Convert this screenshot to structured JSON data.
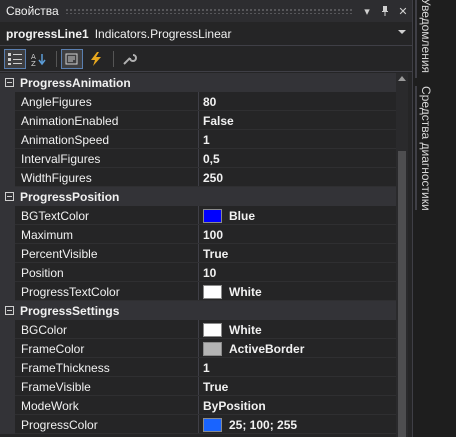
{
  "panel": {
    "title": "Свойства",
    "title_buttons": [
      "▾",
      "ᵖ",
      "✕"
    ]
  },
  "object_selector": {
    "name": "progressLine1",
    "type": "Indicators.ProgressLinear"
  },
  "toolbar": {
    "buttons": [
      {
        "name": "categorized-icon",
        "active": true
      },
      {
        "name": "alphabetical-icon",
        "active": false
      },
      {
        "name": "properties-icon",
        "active": true
      },
      {
        "name": "events-icon",
        "active": false
      },
      {
        "name": "property-pages-icon",
        "active": false
      }
    ]
  },
  "grid": {
    "categories": [
      {
        "name": "ProgressAnimation",
        "props": [
          {
            "name": "AngleFigures",
            "value": "80"
          },
          {
            "name": "AnimationEnabled",
            "value": "False"
          },
          {
            "name": "AnimationSpeed",
            "value": "1"
          },
          {
            "name": "IntervalFigures",
            "value": "0,5"
          },
          {
            "name": "WidthFigures",
            "value": "250"
          }
        ]
      },
      {
        "name": "ProgressPosition",
        "props": [
          {
            "name": "BGTextColor",
            "value": "Blue",
            "swatch": "#0000ff"
          },
          {
            "name": "Maximum",
            "value": "100"
          },
          {
            "name": "PercentVisible",
            "value": "True"
          },
          {
            "name": "Position",
            "value": "10"
          },
          {
            "name": "ProgressTextColor",
            "value": "White",
            "swatch": "#ffffff"
          }
        ]
      },
      {
        "name": "ProgressSettings",
        "props": [
          {
            "name": "BGColor",
            "value": "White",
            "swatch": "#ffffff"
          },
          {
            "name": "FrameColor",
            "value": "ActiveBorder",
            "swatch": "#b4b4b4"
          },
          {
            "name": "FrameThickness",
            "value": "1"
          },
          {
            "name": "FrameVisible",
            "value": "True"
          },
          {
            "name": "ModeWork",
            "value": "ByPosition"
          },
          {
            "name": "ProgressColor",
            "value": "25; 100; 255",
            "swatch": "#1964ff"
          }
        ]
      }
    ]
  },
  "side_tabs": [
    {
      "label": "Уведомления"
    },
    {
      "label": "Средства диагностики"
    }
  ]
}
